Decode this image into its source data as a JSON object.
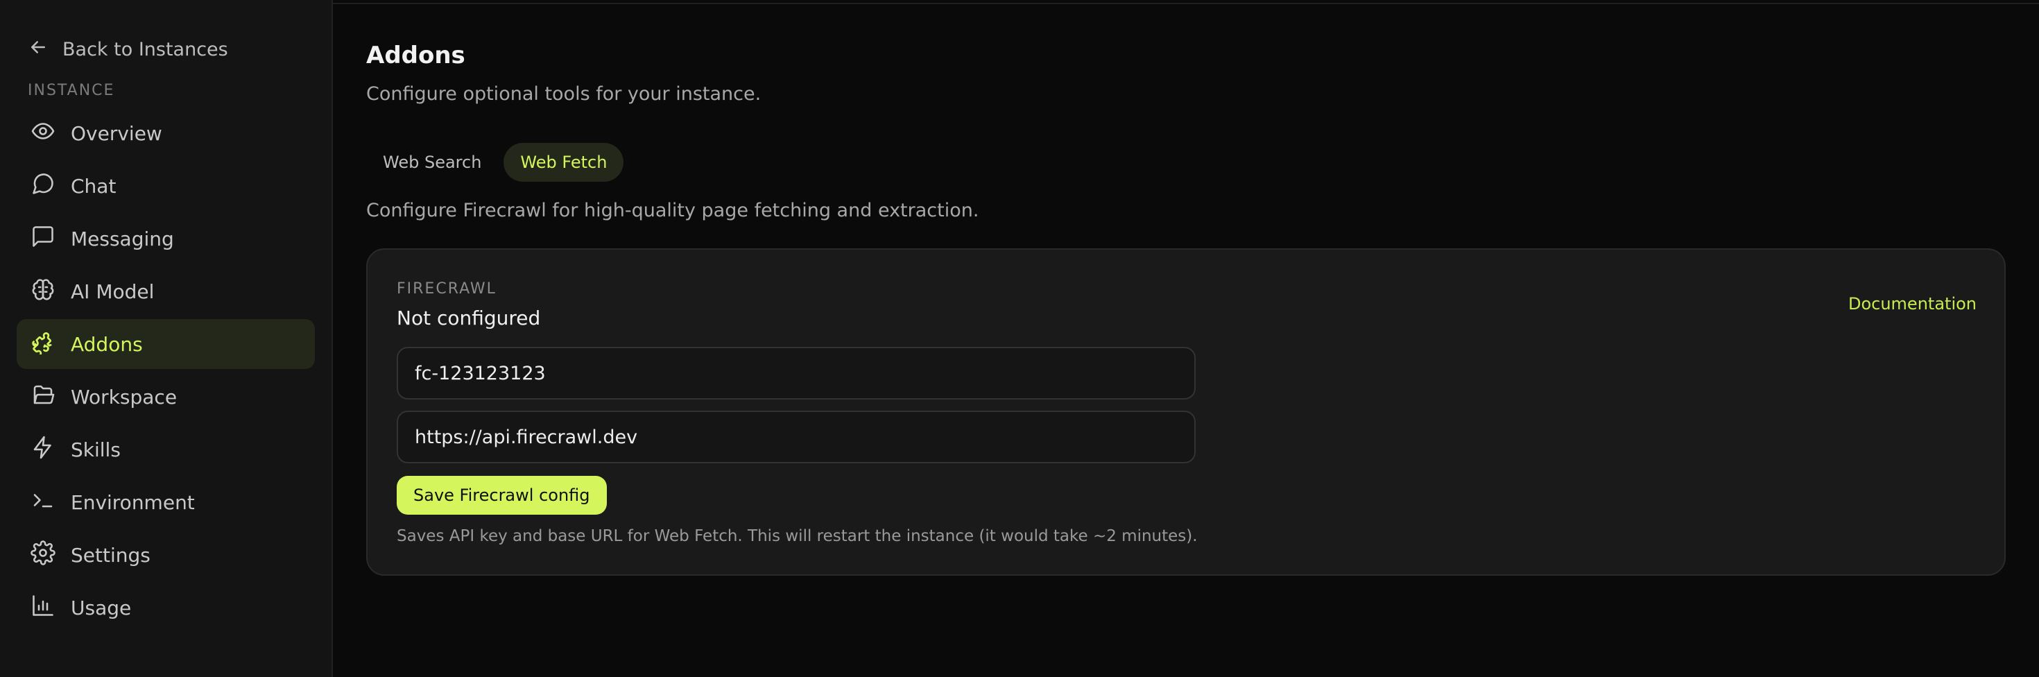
{
  "sidebar": {
    "back_label": "Back to Instances",
    "section_label": "INSTANCE",
    "items": [
      {
        "label": "Overview",
        "icon": "eye-icon"
      },
      {
        "label": "Chat",
        "icon": "chat-bubble-icon"
      },
      {
        "label": "Messaging",
        "icon": "message-square-icon"
      },
      {
        "label": "AI Model",
        "icon": "brain-icon"
      },
      {
        "label": "Addons",
        "icon": "puzzle-icon",
        "active": true
      },
      {
        "label": "Workspace",
        "icon": "folder-open-icon"
      },
      {
        "label": "Skills",
        "icon": "lightning-icon"
      },
      {
        "label": "Environment",
        "icon": "terminal-icon"
      },
      {
        "label": "Settings",
        "icon": "gear-icon"
      },
      {
        "label": "Usage",
        "icon": "bar-chart-icon"
      }
    ]
  },
  "main": {
    "title": "Addons",
    "subtitle": "Configure optional tools for your instance.",
    "tabs": [
      {
        "label": "Web Search",
        "active": false
      },
      {
        "label": "Web Fetch",
        "active": true
      }
    ],
    "section_description": "Configure Firecrawl for high-quality page fetching and extraction.",
    "card": {
      "provider_label": "FIRECRAWL",
      "status": "Not configured",
      "doc_link": "Documentation",
      "api_key_value": "fc-123123123",
      "base_url_value": "https://api.firecrawl.dev",
      "save_label": "Save Firecrawl config",
      "note": "Saves API key and base URL for Web Fetch. This will restart the instance (it would take ~2 minutes)."
    }
  },
  "colors": {
    "accent": "#d4f55c",
    "active_bg": "#23281a",
    "background": "#0a0a0a",
    "sidebar_bg": "#141414",
    "card_bg": "#1a1a1a"
  }
}
